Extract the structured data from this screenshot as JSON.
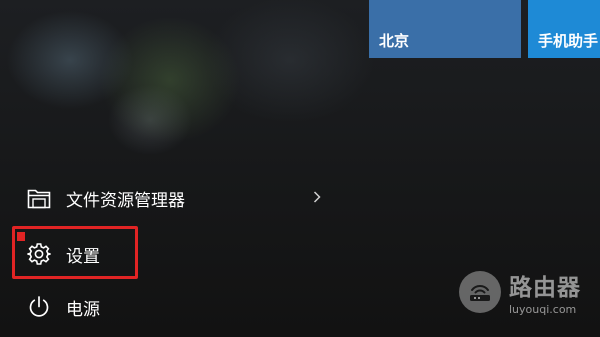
{
  "tiles": [
    {
      "label": "北京",
      "color": "#3a6fa8"
    },
    {
      "label": "手机助手",
      "color": "#1e8ad6"
    }
  ],
  "menu": {
    "file_explorer": {
      "label": "文件资源管理器",
      "icon": "folder-icon",
      "has_submenu": true
    },
    "settings": {
      "label": "设置",
      "icon": "gear-icon",
      "highlighted": true
    },
    "power": {
      "label": "电源",
      "icon": "power-icon"
    }
  },
  "highlight_color": "#e12424",
  "watermark": {
    "title": "路由器",
    "url": "luyouqi.com"
  }
}
